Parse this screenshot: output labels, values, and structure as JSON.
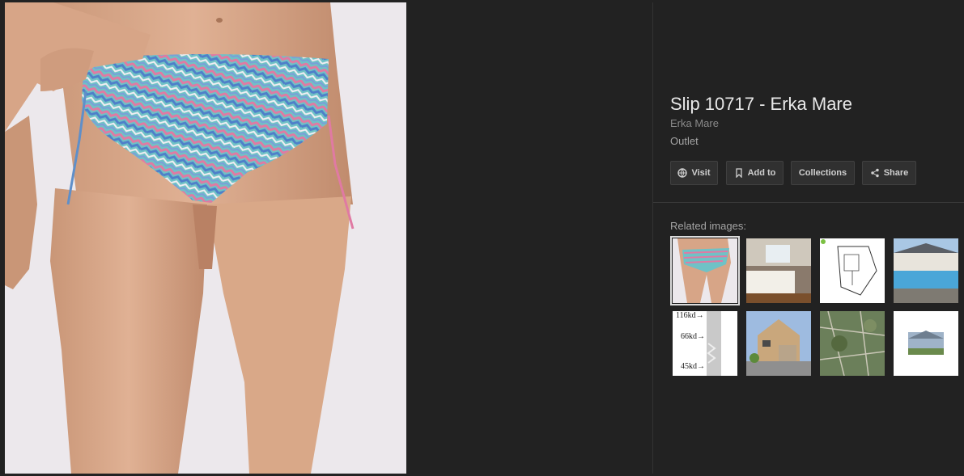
{
  "item": {
    "title": "Slip 10717 - Erka Mare",
    "source": "Erka Mare",
    "subtitle": "Outlet"
  },
  "actions": [
    {
      "label": "Visit",
      "icon": "globe-icon"
    },
    {
      "label": "Add to",
      "icon": "bookmark-icon"
    },
    {
      "label": "Collections",
      "icon": ""
    },
    {
      "label": "Share",
      "icon": "share-icon"
    }
  ],
  "related": {
    "label": "Related images:",
    "chart_thumb_labels": [
      "116kd→",
      "66kd→",
      "45kd→"
    ]
  },
  "colors": {
    "background": "#222222",
    "title": "#e8e8e8",
    "muted": "#a4a4a4",
    "button": "#303030"
  }
}
